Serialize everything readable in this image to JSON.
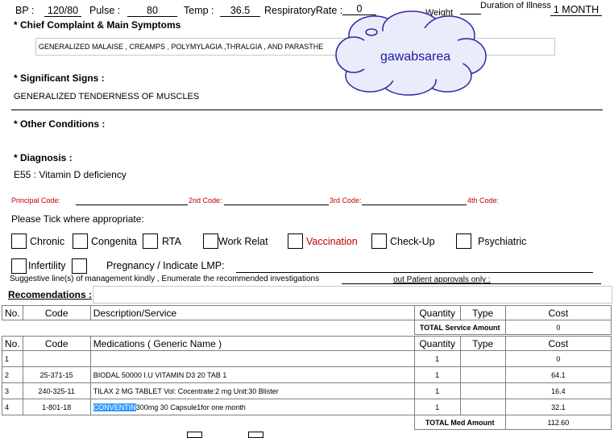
{
  "vitals": {
    "bp_label": "BP :",
    "bp_value": "120/80",
    "pulse_label": "Pulse :",
    "pulse_value": "80",
    "temp_label": "Temp :",
    "temp_value": "36.5",
    "resp_label": "RespiratoryRate :",
    "resp_value": "0",
    "weight_label": "Weight",
    "duration_label": "Duration of Illness",
    "duration_value": "1 MONTH"
  },
  "complaint": {
    "title": "* Chief Complaint & Main Symptoms",
    "value": "GENERALIZED MALAISE , CREAMPS , POLYMYLAGIA ,THRALGIA , AND PARASTHE"
  },
  "cloud": {
    "text": "gawabsarea"
  },
  "signs": {
    "title": "* Significant Signs :",
    "value": "GENERALIZED TENDERNESS OF MUSCLES"
  },
  "other": {
    "title": "* Other Conditions :"
  },
  "diagnosis": {
    "title": "* Diagnosis :",
    "value": "E55 : Vitamin D deficiency"
  },
  "codes": {
    "principal": "Principal Code:",
    "second": "2nd Code:",
    "third": "3rd Code:",
    "fourth": "4th Code:"
  },
  "tick": {
    "label": "Please Tick where appropriate:",
    "options": [
      "Chronic",
      "Congenita",
      "RTA",
      "Work Relat",
      "Vaccination",
      "Check-Up",
      "Psychiatric",
      "Infertility"
    ],
    "pregnancy_label": "Pregnancy / Indicate LMP:"
  },
  "suggestive": "Suggestive line(s) of management kindly , Enumerate the recommended investigations",
  "approvals": "out Patient approvals only :",
  "recommendations_label": "Recomendations :",
  "services": {
    "headers": [
      "No.",
      "Code",
      "Description/Service",
      "Quantity",
      "Type",
      "Cost"
    ],
    "total_label": "TOTAL Service Amount",
    "total_value": "0"
  },
  "medications": {
    "headers": [
      "No.",
      "Code",
      "Medications ( Generic Name )",
      "Quantity",
      "Type",
      "Cost"
    ],
    "rows": [
      {
        "no": "1",
        "code": "",
        "name_sel": "",
        "name": "",
        "qty": "1",
        "type": "",
        "cost": "0"
      },
      {
        "no": "2",
        "code": "25-371-15",
        "name_sel": "",
        "name": "BIODAL 50000 I.U VITAMIN D3 20 TAB 1",
        "qty": "1",
        "type": "",
        "cost": "64.1"
      },
      {
        "no": "3",
        "code": "240-325-11",
        "name_sel": "",
        "name": "TILAX 2 MG TABLET Vol:  Cocentrate:2 mg Unit:30 Blister",
        "qty": "1",
        "type": "",
        "cost": "16.4"
      },
      {
        "no": "4",
        "code": "1-801-18",
        "name_sel": "CONVENTIN",
        "name": "300mg 30 Capsule1for one month",
        "qty": "1",
        "type": "",
        "cost": "32.1"
      }
    ],
    "total_label": "TOTAL Med Amount",
    "total_value": "112.60"
  }
}
